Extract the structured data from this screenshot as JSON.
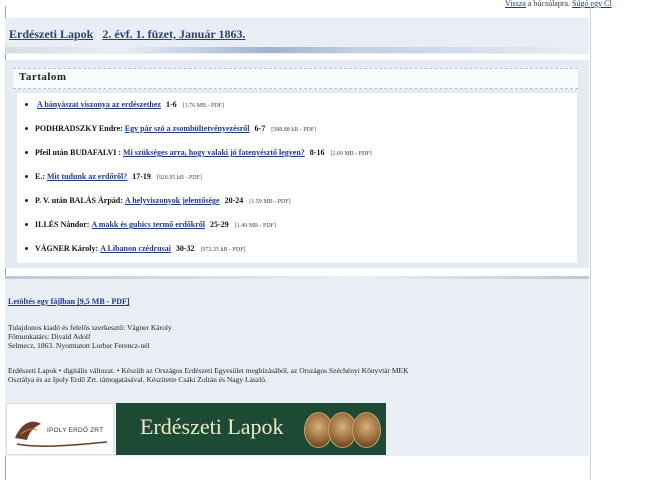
{
  "topnav": {
    "back_link": "Vissza",
    "back_text": "a búcsúlapra.",
    "help_link": "Súgó egy Cl"
  },
  "header": {
    "title_link": "Erdészeti Lapok",
    "issue_link": "2. évf. 1. füzet, Január 1863."
  },
  "toc": {
    "heading": "Tartalom",
    "items": [
      {
        "author": "",
        "title": "A bányászat viszonya az erdészethez",
        "pages": "1-6",
        "pdf": "[1.76 MB - PDF]"
      },
      {
        "author": "PODHRADSZKY Endre:",
        "title": "Egy pár szó a zsombültetvényezésről",
        "pages": "6-7",
        "pdf": "[588.88 kB - PDF]"
      },
      {
        "author": "Pfeil után BUDAFALVI :",
        "title": "Mi szükséges arra, hogy valaki jó fatenyésztő legyen?",
        "pages": "8-16",
        "pdf": "[2.69 MB - PDF]"
      },
      {
        "author": "E.:",
        "title": "Mit tudunk az erdőről?",
        "pages": "17-19",
        "pdf": "[926.95 kB - PDF]"
      },
      {
        "author": "P. V. után BALÁS Árpád:",
        "title": "A helyviszonyok jelentősége",
        "pages": "20-24",
        "pdf": "[1.59 MB - PDF]"
      },
      {
        "author": "ILLÉS Nándor:",
        "title": "A makk és gubics termő erdőkről",
        "pages": "25-29",
        "pdf": "[1.49 MB - PDF]"
      },
      {
        "author": "VÁGNER Károly:",
        "title": "A Libanon czédrusai",
        "pages": "30-32",
        "pdf": "[972.35 kB - PDF]"
      }
    ]
  },
  "bottom": {
    "download_link": "Letöltés egy fájlban [9,5 MB - PDF]",
    "publisher": "Tulajdonos kiadó és felelős szerkesztő: Vágner Károly",
    "coworker": "Főmunkatárs: Divald Adolf",
    "printed": "Selmecz, 1863. Nyomtatott Lorber Ferencz-nél",
    "credits_line1": "Erdészeti Lapok • digitális változat. • Készült az Országos Erdészeti Egyesület megbízásából, az Országos Széchényi Könyvtár MEK",
    "credits_line2": "Osztálya és az Ipoly Erdő Zrt. támogatásával. Készítette Csáki Zoltán és Nagy László."
  },
  "logos": {
    "ipoly_text": "IPOLY ERDŐ ZRT",
    "el_text": "Erdészeti Lapok"
  },
  "colors": {
    "link": "#1f3a8a",
    "panel": "#e5ebf3",
    "logo_green": "#1c4a34"
  }
}
